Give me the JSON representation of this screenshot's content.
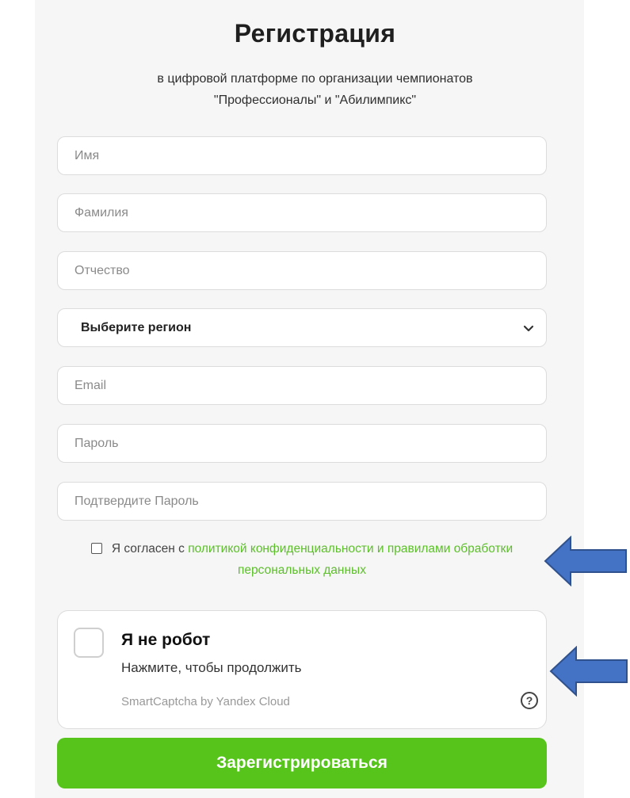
{
  "header": {
    "title": "Регистрация",
    "subtitle_line1": "в цифровой платформе по организации чемпионатов",
    "subtitle_line2": "\"Профессионалы\" и \"Абилимпикс\""
  },
  "form": {
    "first_name": {
      "placeholder": "Имя",
      "value": ""
    },
    "last_name": {
      "placeholder": "Фамилия",
      "value": ""
    },
    "middle_name": {
      "placeholder": "Отчество",
      "value": ""
    },
    "region": {
      "selected": "Выберите регион"
    },
    "email": {
      "placeholder": "Email",
      "value": ""
    },
    "password": {
      "placeholder": "Пароль",
      "value": ""
    },
    "confirm_password": {
      "placeholder": "Подтвердите Пароль",
      "value": ""
    }
  },
  "consent": {
    "checked": false,
    "prefix": "Я согласен с ",
    "link_text": "политикой конфиденциальности и правилами обработки персональных данных"
  },
  "captcha": {
    "title": "Я не робот",
    "subtitle": "Нажмите, чтобы продолжить",
    "brand": "SmartCaptcha by Yandex Cloud",
    "help_symbol": "?"
  },
  "submit": {
    "label": "Зарегистрироваться"
  },
  "colors": {
    "accent_green": "#56c41b",
    "link_green": "#5cbf2a",
    "arrow_blue": "#4472c4",
    "panel_bg": "#f6f6f6"
  },
  "icons": {
    "select_chevron": "chevron-down-icon",
    "captcha_help": "question-circle-icon",
    "annotation": "left-arrow-icon"
  }
}
